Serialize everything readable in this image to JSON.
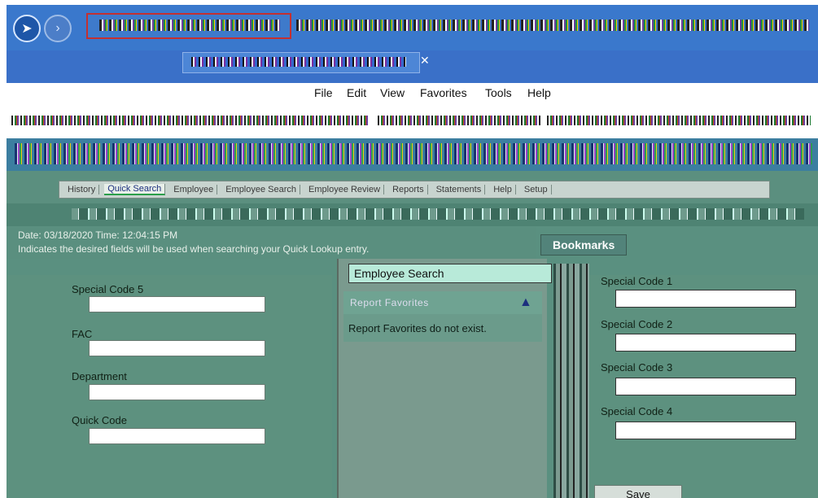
{
  "browser": {
    "menu": [
      "File",
      "Edit",
      "View",
      "Favorites",
      "Tools",
      "Help"
    ]
  },
  "app": {
    "module_tabs": [
      "History",
      "Quick Search",
      "Employee",
      "Employee Search",
      "Employee Review",
      "Reports",
      "Statements",
      "Help",
      "Setup"
    ],
    "info": {
      "datetime": "Date: 03/18/2020  Time: 12:04:15 PM",
      "note": "Indicates the desired fields will be used when searching your Quick Lookup entry."
    }
  },
  "left_fields": [
    {
      "label": "Special Code 5",
      "value": ""
    },
    {
      "label": "FAC",
      "value": ""
    },
    {
      "label": "Department",
      "value": ""
    },
    {
      "label": "Quick Code",
      "value": ""
    }
  ],
  "center": {
    "search_title": "Employee Search",
    "favorites_header": "Report Favorites",
    "favorites_empty": "Report Favorites do not exist."
  },
  "bookmarks": {
    "title": "Bookmarks"
  },
  "right_fields": [
    {
      "label": "Special Code 1",
      "value": ""
    },
    {
      "label": "Special Code 2",
      "value": ""
    },
    {
      "label": "Special Code 3",
      "value": ""
    },
    {
      "label": "Special Code 4",
      "value": ""
    }
  ],
  "actions": {
    "save_label": "Save"
  },
  "colors": {
    "browser_blue": "#3a78cc",
    "panel_green": "#5d917f",
    "search_highlight": "#b8ead9",
    "address_border": "#c43030"
  }
}
